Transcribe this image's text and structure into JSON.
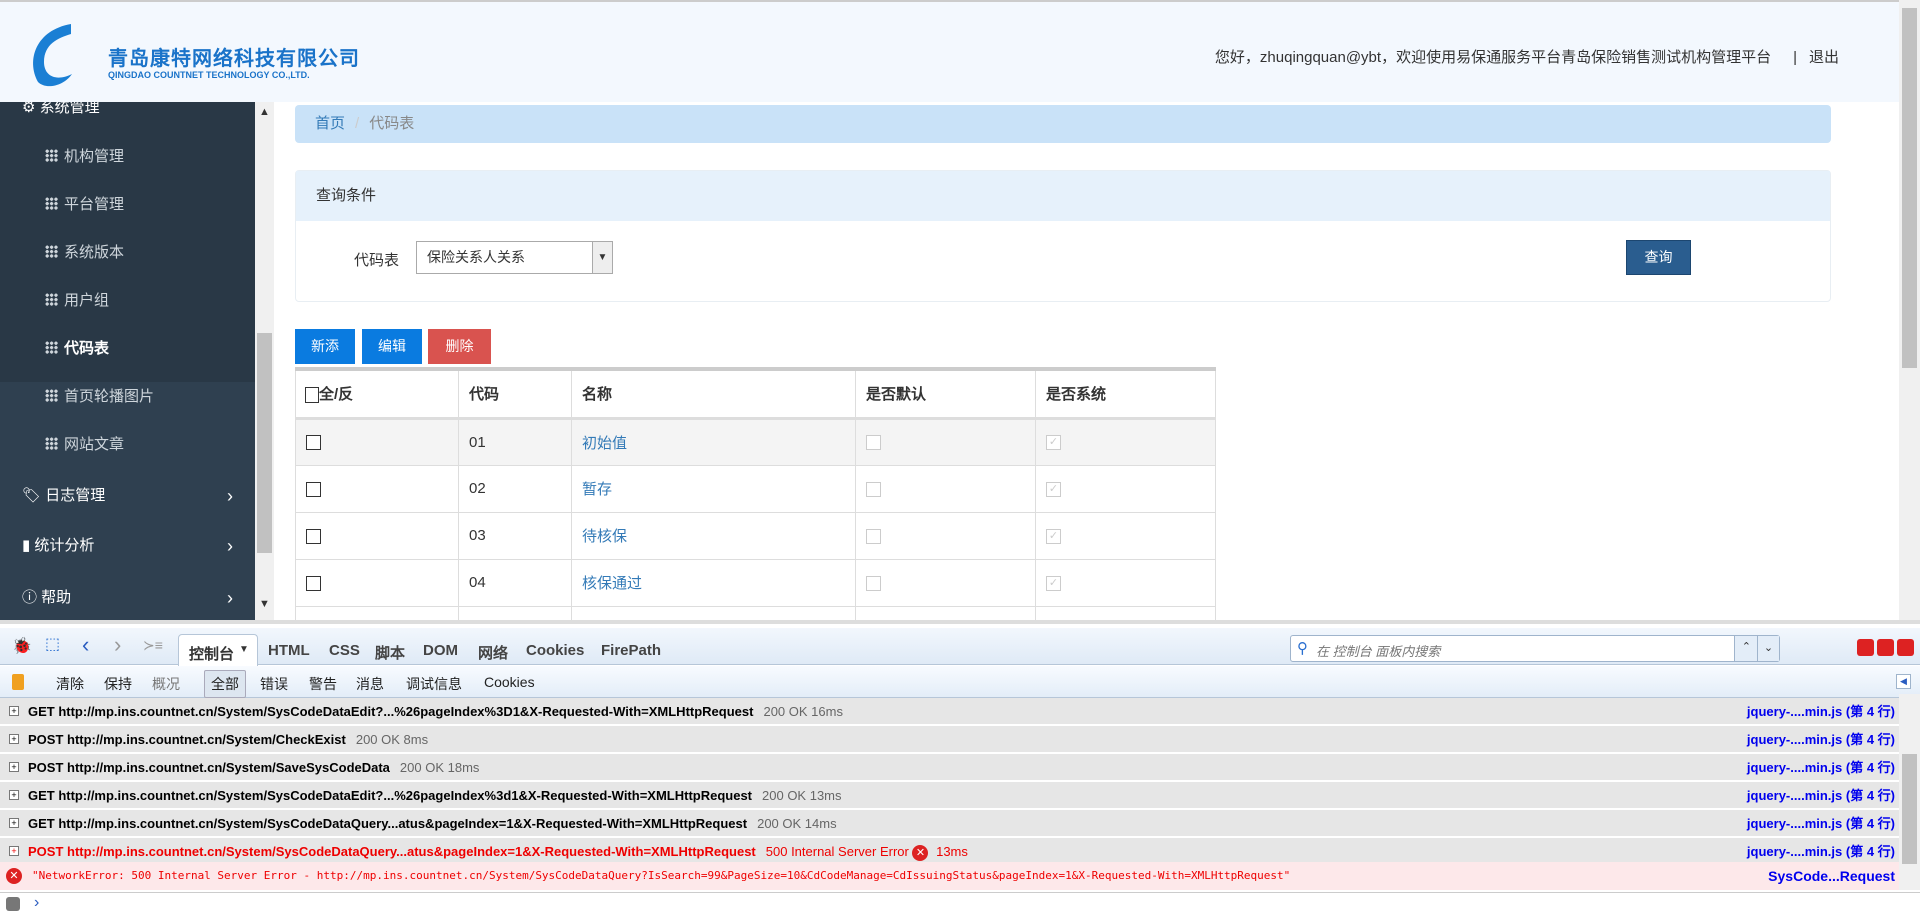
{
  "header": {
    "company_cn": "青岛康特网络科技有限公司",
    "company_en": "QINGDAO COUNTNET TECHNOLOGY CO.,LTD.",
    "welcome": "您好，zhuqingquan@ybt，欢迎使用易保通服务平台青岛保险销售测试机构管理平台",
    "separator": "|",
    "logout": "退出"
  },
  "sidebar": {
    "group": "系统管理",
    "items": [
      "机构管理",
      "平台管理",
      "系统版本",
      "用户组",
      "代码表",
      "首页轮播图片",
      "网站文章"
    ],
    "active": "代码表",
    "menus": [
      "日志管理",
      "统计分析",
      "帮助"
    ]
  },
  "breadcrumb": {
    "home": "首页",
    "sep": "/",
    "current": "代码表"
  },
  "query": {
    "title": "查询条件",
    "label": "代码表",
    "selected": "保险关系人关系",
    "button": "查询"
  },
  "actions": {
    "add": "新添",
    "edit": "编辑",
    "delete": "删除"
  },
  "table": {
    "headers": [
      "全/反",
      "代码",
      "名称",
      "是否默认",
      "是否系统"
    ],
    "rows": [
      {
        "code": "01",
        "name": "初始值",
        "default": false,
        "system": true
      },
      {
        "code": "02",
        "name": "暂存",
        "default": false,
        "system": true
      },
      {
        "code": "03",
        "name": "待核保",
        "default": false,
        "system": true
      },
      {
        "code": "04",
        "name": "核保通过",
        "default": false,
        "system": true
      }
    ]
  },
  "firebug": {
    "tabs": [
      "控制台",
      "HTML",
      "CSS",
      "脚本",
      "DOM",
      "网络",
      "Cookies",
      "FirePath"
    ],
    "search_placeholder": "在 控制台 面板内搜索",
    "filters": [
      "清除",
      "保持",
      "概况",
      "全部",
      "错误",
      "警告",
      "消息",
      "调试信息",
      "Cookies"
    ],
    "logs": [
      {
        "text": "GET http://mp.ins.countnet.cn/System/SysCodeDataEdit?...%26pageIndex%3D1&X-Requested-With=XMLHttpRequest",
        "status": "200 OK 16ms",
        "src": "jquery-....min.js (第 4 行)"
      },
      {
        "text": "POST http://mp.ins.countnet.cn/System/CheckExist",
        "status": "200 OK 8ms",
        "src": "jquery-....min.js (第 4 行)"
      },
      {
        "text": "POST http://mp.ins.countnet.cn/System/SaveSysCodeData",
        "status": "200 OK 18ms",
        "src": "jquery-....min.js (第 4 行)"
      },
      {
        "text": "GET http://mp.ins.countnet.cn/System/SysCodeDataEdit?...%26pageIndex%3d1&X-Requested-With=XMLHttpRequest",
        "status": "200 OK 13ms",
        "src": "jquery-....min.js (第 4 行)"
      },
      {
        "text": "GET http://mp.ins.countnet.cn/System/SysCodeDataQuery...atus&pageIndex=1&X-Requested-With=XMLHttpRequest",
        "status": "200 OK 14ms",
        "src": "jquery-....min.js (第 4 行)"
      },
      {
        "text": "POST http://mp.ins.countnet.cn/System/SysCodeDataQuery...atus&pageIndex=1&X-Requested-With=XMLHttpRequest",
        "status": "500 Internal Server Error",
        "time": "13ms",
        "src": "jquery-....min.js (第 4 行)"
      }
    ],
    "error": {
      "text": "\"NetworkError: 500 Internal Server Error - http://mp.ins.countnet.cn/System/SysCodeDataQuery?IsSearch=99&PageSize=10&CdCodeManage=CdIssuingStatus&pageIndex=1&X-Requested-With=XMLHttpRequest\"",
      "src": "SysCode...Request"
    },
    "prompt": "›"
  }
}
